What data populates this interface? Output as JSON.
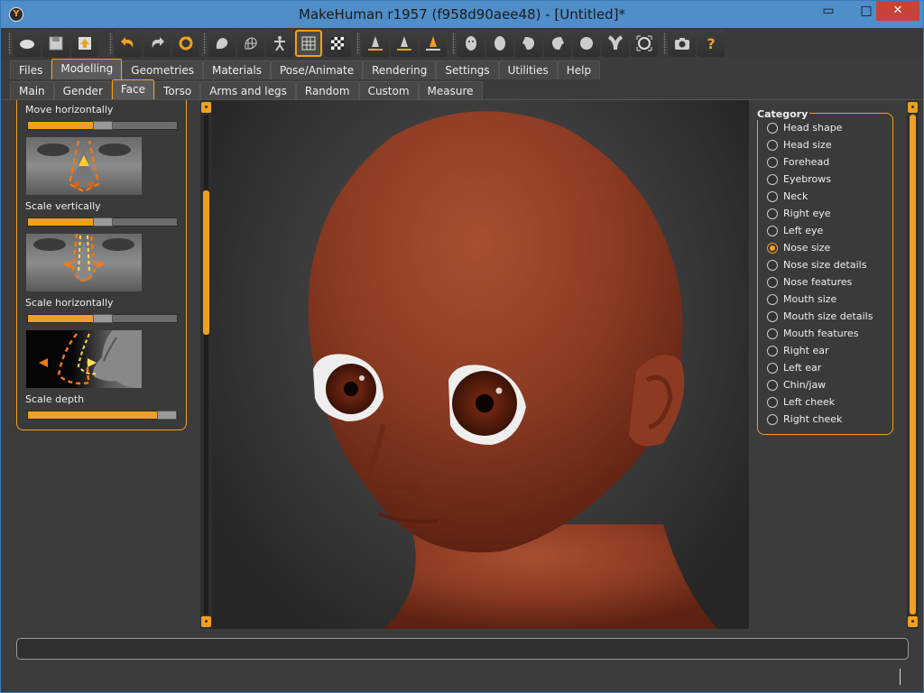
{
  "window": {
    "title": "MakeHuman r1957 (f958d90aee48) - [Untitled]*",
    "min_glyph": "▭",
    "max_glyph": "□",
    "close_glyph": "✕"
  },
  "toolbar": {
    "groups": [
      [
        "hide-icon",
        "save-icon",
        "export-icon"
      ],
      [
        "undo-icon",
        "redo-icon",
        "reset-icon"
      ],
      [
        "smooth-icon",
        "wireframe-icon",
        "pose-icon",
        "grid-icon",
        "background-icon"
      ],
      [
        "front-view-icon",
        "back-view-icon",
        "side-view-icon"
      ],
      [
        "face-front-icon",
        "face-back-icon",
        "face-left-icon",
        "face-right-icon",
        "face-top-icon",
        "face-bottom-icon",
        "reset-camera-icon"
      ],
      [
        "screenshot-icon",
        "help-icon"
      ]
    ],
    "active": "grid-icon",
    "help_glyph": "?"
  },
  "main_tabs": [
    "Files",
    "Modelling",
    "Geometries",
    "Materials",
    "Pose/Animate",
    "Rendering",
    "Settings",
    "Utilities",
    "Help"
  ],
  "main_tab_active": "Modelling",
  "sub_tabs": [
    "Main",
    "Gender",
    "Face",
    "Torso",
    "Arms and legs",
    "Random",
    "Custom",
    "Measure"
  ],
  "sub_tab_active": "Face",
  "left_panel": {
    "sliders": [
      {
        "label": "Move horizontally",
        "value": 0.5
      },
      {
        "label": "Scale vertically",
        "value": 0.5
      },
      {
        "label": "Scale horizontally",
        "value": 0.5
      },
      {
        "label": "Scale depth",
        "value": 1.0
      }
    ]
  },
  "category": {
    "title": "Category",
    "items": [
      "Head shape",
      "Head size",
      "Forehead",
      "Eyebrows",
      "Neck",
      "Right eye",
      "Left eye",
      "Nose size",
      "Nose size details",
      "Nose features",
      "Mouth size",
      "Mouth size details",
      "Mouth features",
      "Right ear",
      "Left ear",
      "Chin/jaw",
      "Left cheek",
      "Right cheek"
    ],
    "selected": "Nose size"
  },
  "status": {
    "text": ""
  },
  "colors": {
    "accent": "#f0a020",
    "skin": "#8e3f26",
    "titlebar": "#4f8ec9"
  }
}
